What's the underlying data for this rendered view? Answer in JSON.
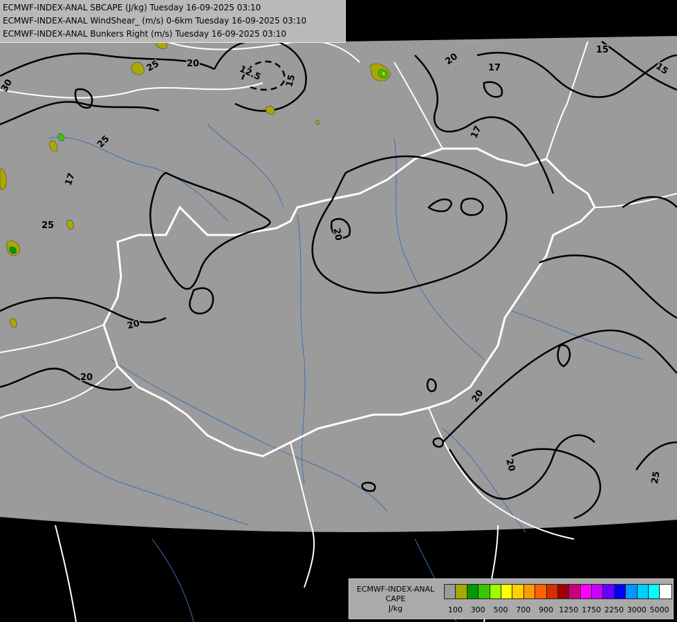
{
  "header": {
    "lines": [
      "ECMWF-INDEX-ANAL SBCAPE (J/kg) Tuesday 16-09-2025 03:10",
      "ECMWF-INDEX-ANAL WindShear_ (m/s) 0-6km Tuesday 16-09-2025 03:10",
      "ECMWF-INDEX-ANAL Bunkers Right (m/s) Tuesday 16-09-2025 03:10"
    ]
  },
  "map": {
    "domain_color": "#9b9b9b",
    "outside_color": "#000000",
    "border_color": "#ffffff",
    "river_color": "#3f6fb5",
    "contour_color": "#000000",
    "contour_labels": [
      "30",
      "25",
      "20",
      "12.5",
      "15",
      "20",
      "17",
      "15",
      "15",
      "17",
      "25",
      "17",
      "25",
      "20",
      "20",
      "20",
      "20",
      "20",
      "25"
    ]
  },
  "legend": {
    "title_lines": [
      "ECMWF-INDEX-ANAL",
      "CAPE",
      "J/kg"
    ],
    "colors": [
      "#9b9b9b",
      "#a8a800",
      "#009a00",
      "#38c800",
      "#9bff00",
      "#ffff00",
      "#ffd000",
      "#ff9a00",
      "#ff6000",
      "#d43000",
      "#a00000",
      "#c80080",
      "#ff00ff",
      "#c800ff",
      "#6400ff",
      "#0000ff",
      "#0096ff",
      "#00d0ff",
      "#00ffff",
      "#ffffff"
    ],
    "tick_labels": [
      "100",
      "300",
      "500",
      "700",
      "900",
      "1250",
      "1750",
      "2250",
      "3000",
      "5000"
    ]
  }
}
